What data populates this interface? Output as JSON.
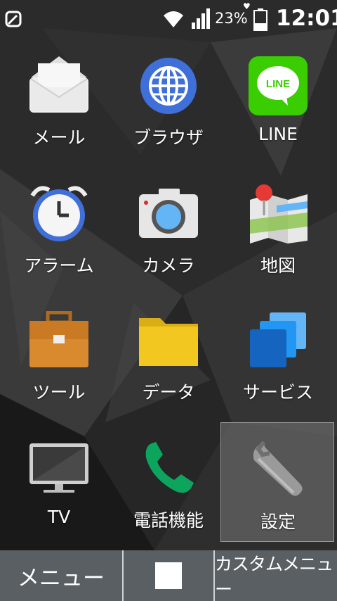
{
  "status_bar": {
    "battery_percent": "23%",
    "time": "12:01",
    "icons": [
      "notification-app-icon",
      "wifi-icon",
      "signal-icon",
      "heart-icon",
      "battery-icon"
    ]
  },
  "apps": [
    {
      "label": "メール",
      "icon": "mail-icon"
    },
    {
      "label": "ブラウザ",
      "icon": "browser-globe-icon"
    },
    {
      "label": "LINE",
      "icon": "line-icon"
    },
    {
      "label": "アラーム",
      "icon": "alarm-clock-icon"
    },
    {
      "label": "カメラ",
      "icon": "camera-icon"
    },
    {
      "label": "地図",
      "icon": "map-icon"
    },
    {
      "label": "ツール",
      "icon": "toolbox-icon"
    },
    {
      "label": "データ",
      "icon": "folder-icon"
    },
    {
      "label": "サービス",
      "icon": "services-icon"
    },
    {
      "label": "TV",
      "icon": "tv-icon"
    },
    {
      "label": "電話機能",
      "icon": "phone-icon"
    },
    {
      "label": "設定",
      "icon": "wrench-settings-icon"
    }
  ],
  "line_badge_text": "LINE",
  "bottom_bar": {
    "menu_label": "メニュー",
    "custom_menu_label": "カスタムメニュー"
  },
  "colors": {
    "bottom_bar": "#5a5f63",
    "line_green": "#3ACD01",
    "browser_blue": "#3F6FD8",
    "folder_yellow": "#F2C820",
    "toolbox_orange": "#D98A2E",
    "phone_green": "#0DA55E"
  }
}
